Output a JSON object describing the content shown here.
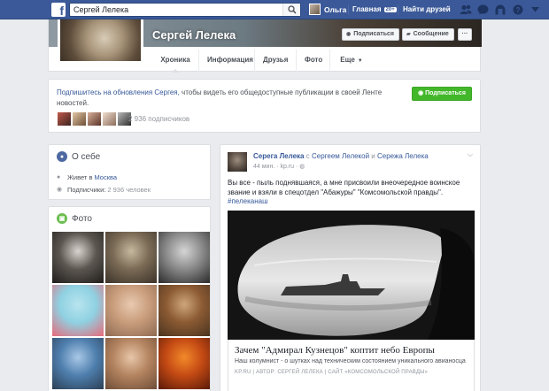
{
  "topbar": {
    "search_value": "Сергей Лелека",
    "user_name": "Ольга",
    "home_label": "Главная",
    "home_badge": "20+",
    "find_friends_label": "Найти друзей"
  },
  "profile": {
    "name": "Сергей Лелека",
    "subscribe_btn": "Подписаться",
    "message_btn": "Сообщение",
    "more_btn": "···",
    "tabs": [
      {
        "label": "Хроника"
      },
      {
        "label": "Информация"
      },
      {
        "label": "Друзья"
      },
      {
        "label": "Фото"
      },
      {
        "label": "Еще"
      }
    ]
  },
  "subscribe_card": {
    "link_text": "Подпишитесь на обновления Сергея,",
    "text": " чтобы видеть его общедоступные публикации в своей Ленте новостей.",
    "button": "Подписаться",
    "count": "2 936 подписчиков"
  },
  "about": {
    "title": "О себе",
    "lives_label": "Живет в",
    "lives_value": "Москва",
    "followers_label": "Подписчики:",
    "followers_value": "2 936 человек"
  },
  "photos": {
    "title": "Фото",
    "items": [
      {
        "colors": [
          "#d9d4cf",
          "#5b5650",
          "#1e1c1a"
        ]
      },
      {
        "colors": [
          "#c6b79e",
          "#7a6a55",
          "#3b3229"
        ]
      },
      {
        "colors": [
          "#d5d5d5",
          "#8a8a8a",
          "#2a2a2a"
        ]
      },
      {
        "colors": [
          "#b8e4ee",
          "#8fd1e2",
          "#e86a7a"
        ]
      },
      {
        "colors": [
          "#e8c9b0",
          "#c99d7c",
          "#8e6a52"
        ]
      },
      {
        "colors": [
          "#cfa67c",
          "#8b5a33",
          "#4a3420"
        ]
      },
      {
        "colors": [
          "#a9c8e6",
          "#4f7fae",
          "#2b3f55"
        ]
      },
      {
        "colors": [
          "#e7c6a8",
          "#b48460",
          "#6e4d38"
        ]
      },
      {
        "colors": [
          "#f28a2a",
          "#c44a14",
          "#5a1a08"
        ]
      }
    ]
  },
  "post": {
    "author": "Серега Лелека",
    "with": " с ",
    "tagged1": "Сергеем Лелекой",
    "and": " и ",
    "tagged2": "Сережа Лелека",
    "time": "44 мин.",
    "source": "kp.ru",
    "text": "Вы все - пыль поднявшаяся, а мне присвоили внеочередное воинское звание и взяли в спецотдел \"Абажуры\" \"Комсомольской правды\".",
    "hashtag": "#пелеканаш",
    "link_title": "Зачем \"Адмирал Кузнецов\" коптит небо Европы",
    "link_desc": "Наш колумнист - о шутках над техническим состоянием уникального авианосца",
    "link_source": "KP.RU | АВТОР: СЕРГЕЙ ЛЕЛЕКА | САЙТ «КОМСОМОЛЬСКОЙ ПРАВДЫ»"
  },
  "colors": {
    "brand": "#3b5998",
    "link": "#365899",
    "green": "#42b72a"
  }
}
